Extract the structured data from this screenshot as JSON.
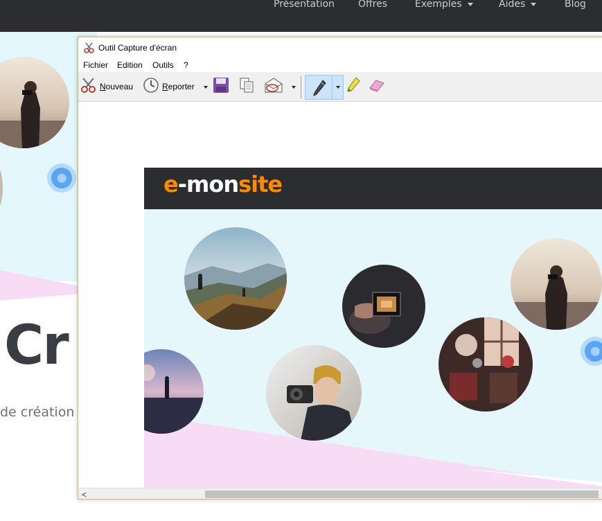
{
  "site": {
    "nav": [
      {
        "label": "Présentation",
        "has_caret": false
      },
      {
        "label": "Offres",
        "has_caret": false
      },
      {
        "label": "Exemples",
        "has_caret": true
      },
      {
        "label": "Aides",
        "has_caret": true
      },
      {
        "label": "Blog",
        "has_caret": false
      }
    ],
    "heading_partial": "Cr",
    "subtitle_partial": "de création"
  },
  "window": {
    "title": "Outil Capture d'écran",
    "menu": [
      "Fichier",
      "Edition",
      "Outils",
      "?"
    ],
    "toolbar": {
      "new_label": "Nouveau",
      "new_accel": "N",
      "new_rest": "ouveau",
      "delay_label": "Reporter",
      "delay_accel": "R",
      "delay_rest": "eporter",
      "save_icon": "save-icon",
      "copy_icon": "copy-icon",
      "send_icon": "send-email-icon",
      "pen_icon": "pen-icon",
      "highlighter_icon": "highlighter-icon",
      "eraser_icon": "eraser-icon"
    },
    "scrollbar": {
      "left_arrow": "<"
    }
  },
  "capture": {
    "logo_part1": "e",
    "logo_part2": "-mon",
    "logo_part3": "site"
  },
  "colors": {
    "site_nav": "#2b2d30",
    "brand_orange": "#ff8a00",
    "light_cyan": "#e6f7fc",
    "pink": "#f8dcf6",
    "accent_blue": "#5aa3f5"
  }
}
